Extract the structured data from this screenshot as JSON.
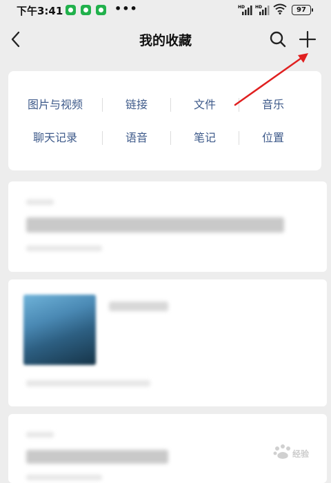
{
  "status_bar": {
    "time": "下午3:41",
    "more": "•••",
    "battery": "97"
  },
  "nav": {
    "title": "我的收藏"
  },
  "categories": {
    "row1": [
      "图片与视频",
      "链接",
      "文件",
      "音乐"
    ],
    "row2": [
      "聊天记录",
      "语音",
      "笔记",
      "位置"
    ]
  },
  "icons": {
    "back": "chevron-left-icon",
    "search": "search-icon",
    "add": "plus-icon"
  },
  "colors": {
    "category_text": "#3e5a8a",
    "annotation_arrow": "#e02020",
    "status_app_icon": "#21b14c"
  }
}
